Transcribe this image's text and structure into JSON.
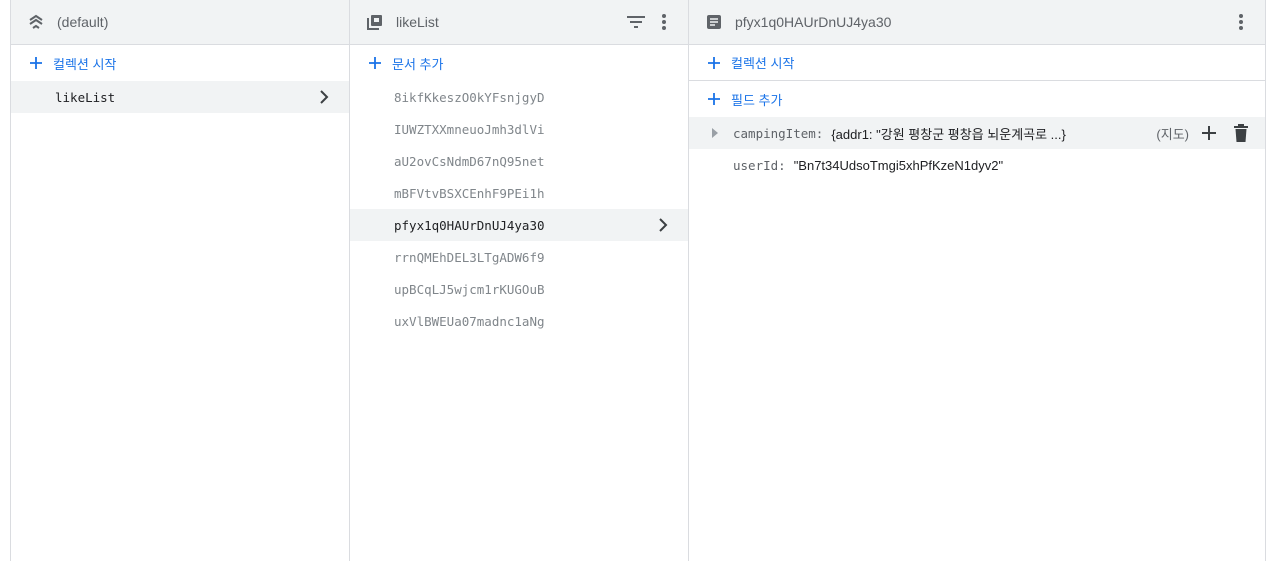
{
  "col1": {
    "title": "(default)",
    "add_label": "컬렉션 시작",
    "items": [
      {
        "label": "likeList",
        "selected": true
      }
    ]
  },
  "col2": {
    "title": "likeList",
    "add_label": "문서 추가",
    "items": [
      {
        "label": "8ikfKkeszO0kYFsnjgyD"
      },
      {
        "label": "IUWZTXXmneuoJmh3dlVi"
      },
      {
        "label": "aU2ovCsNdmD67nQ95net"
      },
      {
        "label": "mBFVtvBSXCEnhF9PEi1h"
      },
      {
        "label": "pfyx1q0HAUrDnUJ4ya30",
        "selected": true
      },
      {
        "label": "rrnQMEhDEL3LTgADW6f9"
      },
      {
        "label": "upBCqLJ5wjcm1rKUGOuB"
      },
      {
        "label": "uxVlBWEUa07madnc1aNg"
      }
    ]
  },
  "col3": {
    "title": "pfyx1q0HAUrDnUJ4ya30",
    "add_collection_label": "컬렉션 시작",
    "add_field_label": "필드 추가",
    "fields": [
      {
        "key": "campingItem",
        "value": "{addr1: \"강원 평창군 평창읍 뇌운계곡로 ...}",
        "type": "(지도)"
      },
      {
        "key": "userId",
        "value": "\"Bn7t34UdsoTmgi5xhPfKzeN1dyv2\""
      }
    ]
  },
  "colors": {
    "accent": "#1a73e8",
    "header_bg": "#f1f3f4",
    "border": "#dadce0"
  }
}
